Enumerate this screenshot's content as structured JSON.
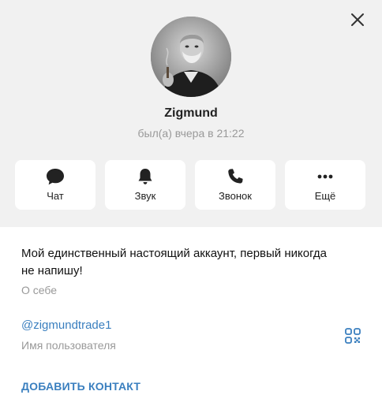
{
  "profile": {
    "name": "Zigmund",
    "status": "был(а) вчера в 21:22"
  },
  "actions": [
    {
      "label": "Чат",
      "icon": "chat-icon"
    },
    {
      "label": "Звук",
      "icon": "bell-icon"
    },
    {
      "label": "Звонок",
      "icon": "phone-icon"
    },
    {
      "label": "Ещё",
      "icon": "more-icon"
    }
  ],
  "info": {
    "bio": "Мой единственный настоящий аккаунт, первый никогда не напишу!",
    "bio_caption": "О себе",
    "username": "@zigmundtrade1",
    "username_caption": "Имя пользователя"
  },
  "add_contact_label": "ДОБАВИТЬ КОНТАКТ",
  "colors": {
    "accent": "#3a7fbf",
    "header_bg": "#f1f1f1",
    "muted": "#999999"
  }
}
